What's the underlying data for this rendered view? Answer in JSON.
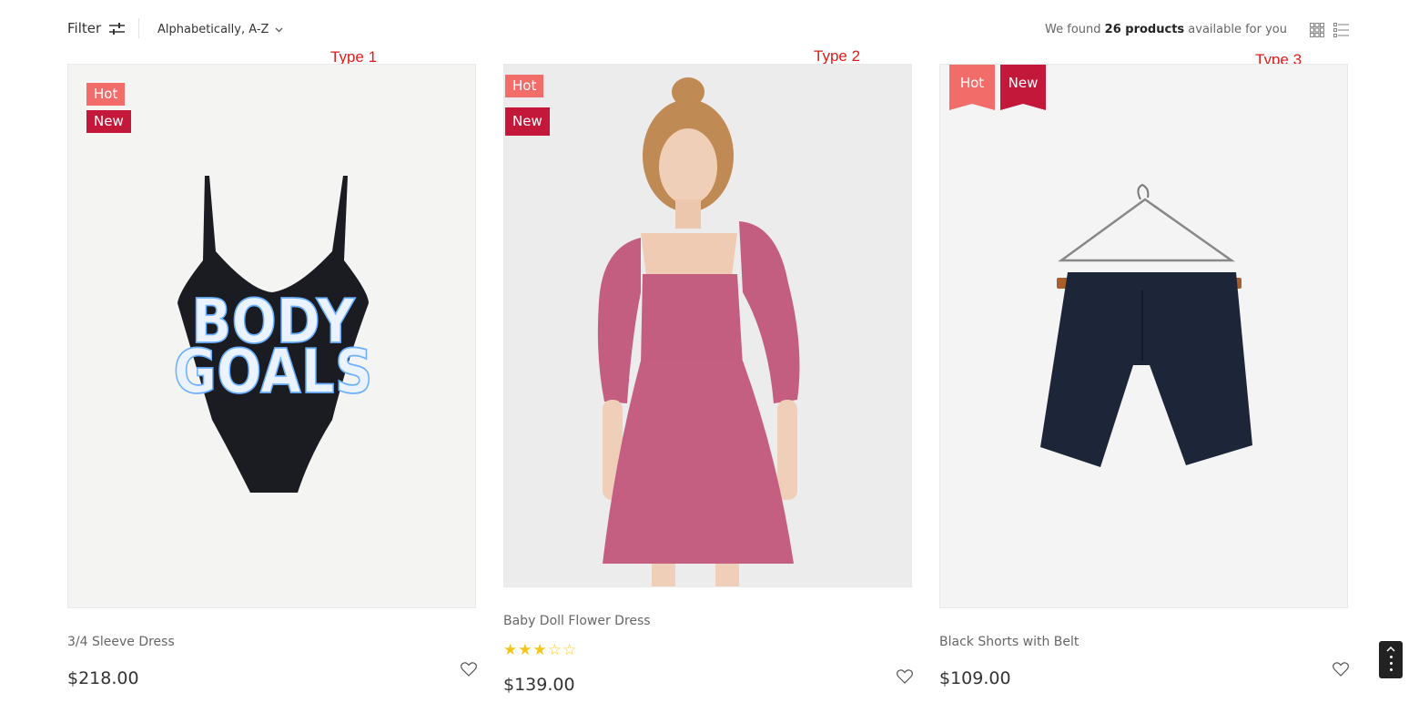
{
  "toolbar": {
    "filter_label": "Filter",
    "sort_value": "Alphabetically, A-Z",
    "result_prefix": "We found",
    "result_count": "26 products",
    "result_suffix": "available for you",
    "icons": {
      "filter": "sliders-icon",
      "sort": "chevron-down-icon",
      "grid": "grid-view-icon",
      "list": "list-view-icon"
    }
  },
  "annotations": [
    "Type 1",
    "Type 2",
    "Type 3"
  ],
  "products": [
    {
      "badges": [
        "Hot",
        "New"
      ],
      "title": "3/4 Sleeve Dress",
      "price": "$218.00",
      "rating": null,
      "image": "black-bodysuit-body-goals"
    },
    {
      "badges": [
        "Hot",
        "New"
      ],
      "title": "Baby Doll Flower Dress",
      "price": "$139.00",
      "rating": 3,
      "rating_max": 5,
      "image": "model-pink-dress"
    },
    {
      "badges": [
        "Hot",
        "New"
      ],
      "title": "Black Shorts with Belt",
      "price": "$109.00",
      "rating": null,
      "image": "navy-shorts-on-hanger"
    }
  ],
  "colors": {
    "hot": "#f26d6a",
    "new": "#c4183a",
    "annotation": "#e01b1b",
    "star": "#f5c518"
  },
  "scroll_top": {
    "icon": "chevron-up-icon"
  }
}
